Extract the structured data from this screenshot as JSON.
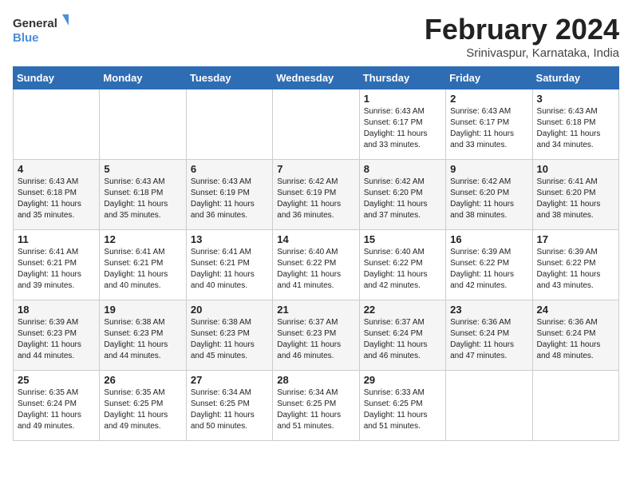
{
  "header": {
    "logo_general": "General",
    "logo_blue": "Blue",
    "title": "February 2024",
    "subtitle": "Srinivaspur, Karnataka, India"
  },
  "days_of_week": [
    "Sunday",
    "Monday",
    "Tuesday",
    "Wednesday",
    "Thursday",
    "Friday",
    "Saturday"
  ],
  "weeks": [
    [
      {
        "day": "",
        "info": ""
      },
      {
        "day": "",
        "info": ""
      },
      {
        "day": "",
        "info": ""
      },
      {
        "day": "",
        "info": ""
      },
      {
        "day": "1",
        "info": "Sunrise: 6:43 AM\nSunset: 6:17 PM\nDaylight: 11 hours and 33 minutes."
      },
      {
        "day": "2",
        "info": "Sunrise: 6:43 AM\nSunset: 6:17 PM\nDaylight: 11 hours and 33 minutes."
      },
      {
        "day": "3",
        "info": "Sunrise: 6:43 AM\nSunset: 6:18 PM\nDaylight: 11 hours and 34 minutes."
      }
    ],
    [
      {
        "day": "4",
        "info": "Sunrise: 6:43 AM\nSunset: 6:18 PM\nDaylight: 11 hours and 35 minutes."
      },
      {
        "day": "5",
        "info": "Sunrise: 6:43 AM\nSunset: 6:18 PM\nDaylight: 11 hours and 35 minutes."
      },
      {
        "day": "6",
        "info": "Sunrise: 6:43 AM\nSunset: 6:19 PM\nDaylight: 11 hours and 36 minutes."
      },
      {
        "day": "7",
        "info": "Sunrise: 6:42 AM\nSunset: 6:19 PM\nDaylight: 11 hours and 36 minutes."
      },
      {
        "day": "8",
        "info": "Sunrise: 6:42 AM\nSunset: 6:20 PM\nDaylight: 11 hours and 37 minutes."
      },
      {
        "day": "9",
        "info": "Sunrise: 6:42 AM\nSunset: 6:20 PM\nDaylight: 11 hours and 38 minutes."
      },
      {
        "day": "10",
        "info": "Sunrise: 6:41 AM\nSunset: 6:20 PM\nDaylight: 11 hours and 38 minutes."
      }
    ],
    [
      {
        "day": "11",
        "info": "Sunrise: 6:41 AM\nSunset: 6:21 PM\nDaylight: 11 hours and 39 minutes."
      },
      {
        "day": "12",
        "info": "Sunrise: 6:41 AM\nSunset: 6:21 PM\nDaylight: 11 hours and 40 minutes."
      },
      {
        "day": "13",
        "info": "Sunrise: 6:41 AM\nSunset: 6:21 PM\nDaylight: 11 hours and 40 minutes."
      },
      {
        "day": "14",
        "info": "Sunrise: 6:40 AM\nSunset: 6:22 PM\nDaylight: 11 hours and 41 minutes."
      },
      {
        "day": "15",
        "info": "Sunrise: 6:40 AM\nSunset: 6:22 PM\nDaylight: 11 hours and 42 minutes."
      },
      {
        "day": "16",
        "info": "Sunrise: 6:39 AM\nSunset: 6:22 PM\nDaylight: 11 hours and 42 minutes."
      },
      {
        "day": "17",
        "info": "Sunrise: 6:39 AM\nSunset: 6:22 PM\nDaylight: 11 hours and 43 minutes."
      }
    ],
    [
      {
        "day": "18",
        "info": "Sunrise: 6:39 AM\nSunset: 6:23 PM\nDaylight: 11 hours and 44 minutes."
      },
      {
        "day": "19",
        "info": "Sunrise: 6:38 AM\nSunset: 6:23 PM\nDaylight: 11 hours and 44 minutes."
      },
      {
        "day": "20",
        "info": "Sunrise: 6:38 AM\nSunset: 6:23 PM\nDaylight: 11 hours and 45 minutes."
      },
      {
        "day": "21",
        "info": "Sunrise: 6:37 AM\nSunset: 6:23 PM\nDaylight: 11 hours and 46 minutes."
      },
      {
        "day": "22",
        "info": "Sunrise: 6:37 AM\nSunset: 6:24 PM\nDaylight: 11 hours and 46 minutes."
      },
      {
        "day": "23",
        "info": "Sunrise: 6:36 AM\nSunset: 6:24 PM\nDaylight: 11 hours and 47 minutes."
      },
      {
        "day": "24",
        "info": "Sunrise: 6:36 AM\nSunset: 6:24 PM\nDaylight: 11 hours and 48 minutes."
      }
    ],
    [
      {
        "day": "25",
        "info": "Sunrise: 6:35 AM\nSunset: 6:24 PM\nDaylight: 11 hours and 49 minutes."
      },
      {
        "day": "26",
        "info": "Sunrise: 6:35 AM\nSunset: 6:25 PM\nDaylight: 11 hours and 49 minutes."
      },
      {
        "day": "27",
        "info": "Sunrise: 6:34 AM\nSunset: 6:25 PM\nDaylight: 11 hours and 50 minutes."
      },
      {
        "day": "28",
        "info": "Sunrise: 6:34 AM\nSunset: 6:25 PM\nDaylight: 11 hours and 51 minutes."
      },
      {
        "day": "29",
        "info": "Sunrise: 6:33 AM\nSunset: 6:25 PM\nDaylight: 11 hours and 51 minutes."
      },
      {
        "day": "",
        "info": ""
      },
      {
        "day": "",
        "info": ""
      }
    ]
  ]
}
